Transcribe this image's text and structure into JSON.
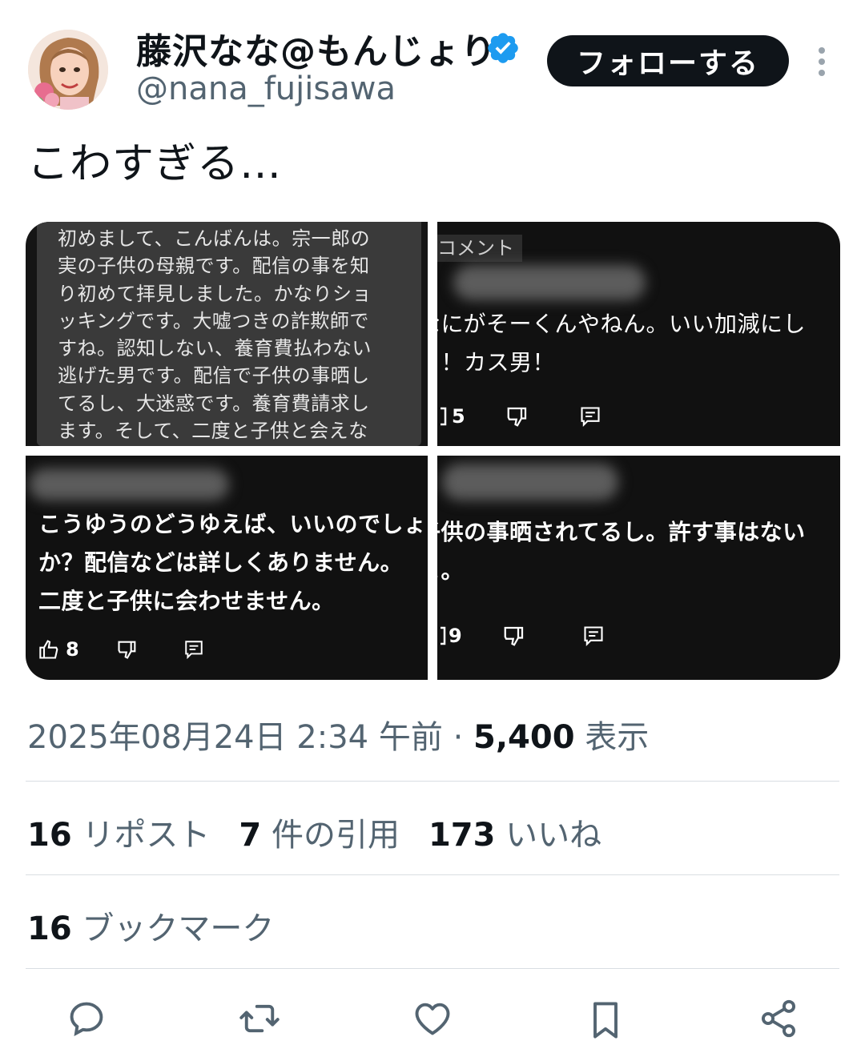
{
  "user": {
    "display_name": "藤沢なな@もんじょり",
    "handle": "@nana_fujisawa",
    "follow_label": "フォローする"
  },
  "tweet": {
    "text": "こわすぎる…"
  },
  "media": {
    "image1_text": "初めまして、こんばんは。宗一郎の\n実の子供の母親です。配信の事を知\nり初めて拝見しました。かなりショ\nッキングです。大嘘つきの詐欺師で\nすね。認知しない、養育費払わない\n逃げた男です。配信で子供の事晒し\nてるし、大迷惑です。養育費請求し\nます。そして、二度と子供と会えな",
    "image2_tag": "コメント",
    "image2_text": "なにがそーくんやねん。いい加減にし\nよ！カス男！",
    "image2_likes": "5",
    "image3_text": "こうゆうのどうゆえば、いいのでしょう\nか？配信などは詳しくありません。\n二度と子供に会わせません。",
    "image3_likes": "8",
    "image4_text": "子供の事晒されてるし。許す事はない\nよ。",
    "image4_likes": "9"
  },
  "meta": {
    "timestamp": "2025年08月24日 2:34 午前",
    "separator": " · ",
    "views": "5,400",
    "views_label": " 表示"
  },
  "stats": {
    "reposts": "16",
    "reposts_label": " リポスト",
    "quotes": "7",
    "quotes_label": " 件の引用",
    "likes": "173",
    "likes_label": " いいね",
    "bookmarks": "16",
    "bookmarks_label": " ブックマーク"
  },
  "colors": {
    "verified": "#1d9bf0",
    "secondary_text": "#536471",
    "primary_text": "#0f1419"
  },
  "icons": [
    "reply-icon",
    "repost-icon",
    "like-icon",
    "bookmark-icon",
    "share-icon",
    "more-icon",
    "verified-icon",
    "thumb-up-icon",
    "thumb-down-icon",
    "comment-icon"
  ]
}
